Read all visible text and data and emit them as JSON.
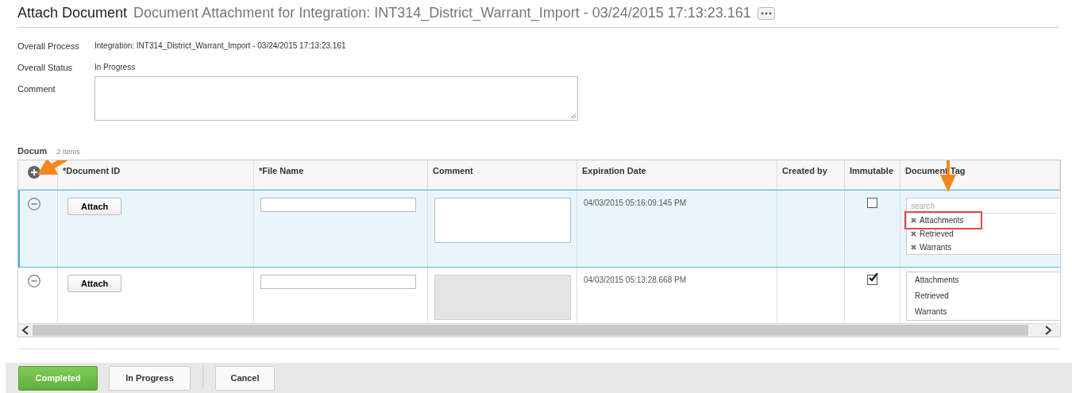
{
  "header": {
    "title": "Attach Document",
    "subtitle": "Document Attachment for Integration: INT314_District_Warrant_Import - 03/24/2015 17:13:23.161"
  },
  "fields": [
    {
      "kind": "text",
      "label": "Overall Process",
      "value": "Integration: INT314_District_Warrant_Import - 03/24/2015 17:13:23.161"
    },
    {
      "kind": "text",
      "label": "Overall Status",
      "value": "In Progress"
    },
    {
      "kind": "textarea",
      "label": "Comment"
    }
  ],
  "documents": {
    "label": "Docum",
    "count": "2 Items",
    "add_pointed": true,
    "columns": [
      {
        "label": "*Document ID",
        "pointed": false
      },
      {
        "label": "*File Name",
        "pointed": false
      },
      {
        "label": "Comment",
        "pointed": false
      },
      {
        "label": "Expiration Date",
        "pointed": false
      },
      {
        "label": "Created by",
        "pointed": false
      },
      {
        "label": "Immutable",
        "pointed": false
      },
      {
        "label": "Document Tag",
        "pointed": true
      }
    ],
    "rows": [
      {
        "selected": true,
        "attach": "Attach",
        "comment_disabled": false,
        "expiration": "04/03/2015 05:16:09.145 PM",
        "immutable": false,
        "tags": {
          "kind": "editor",
          "placeholder": "search",
          "items": [
            {
              "label": "Attachments",
              "highlighted": true
            },
            {
              "label": "Retrieved",
              "highlighted": false
            },
            {
              "label": "Warrants",
              "highlighted": false
            }
          ]
        }
      },
      {
        "selected": false,
        "attach": "Attach",
        "comment_disabled": true,
        "expiration": "04/03/2015 05:13:28.668 PM",
        "immutable": true,
        "tags": {
          "kind": "list",
          "items": [
            {
              "label": "Attachments",
              "highlighted": false
            },
            {
              "label": "Retrieved",
              "highlighted": false
            },
            {
              "label": "Warrants",
              "highlighted": false
            }
          ]
        }
      }
    ]
  },
  "buttons": [
    {
      "label": "Completed",
      "kind": "primary"
    },
    {
      "label": "In Progress",
      "kind": "secondary"
    },
    {
      "label": "Cancel",
      "kind": "cancel"
    }
  ]
}
